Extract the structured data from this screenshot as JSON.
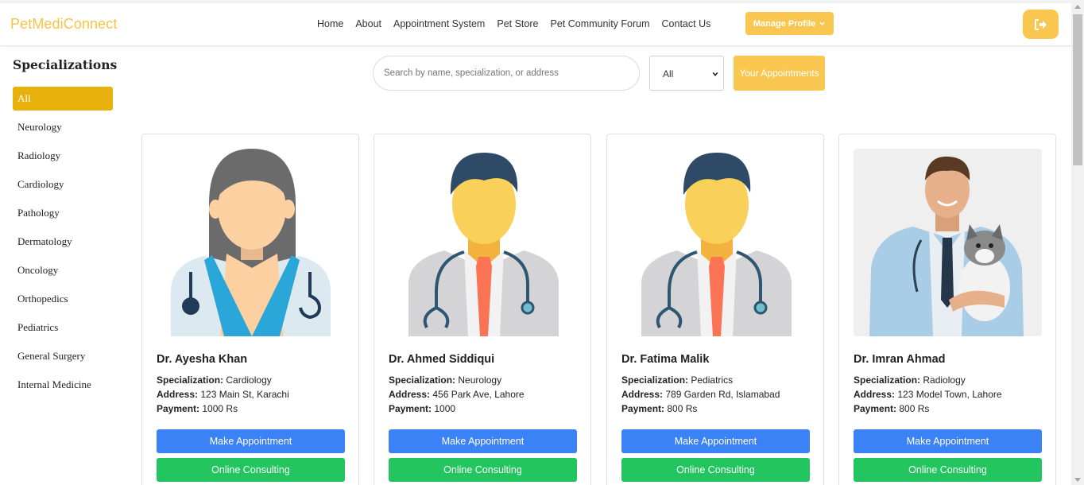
{
  "brand": "PetMediConnect",
  "nav": {
    "links": [
      "Home",
      "About",
      "Appointment System",
      "Pet Store",
      "Pet Community Forum",
      "Contact Us"
    ],
    "manage_profile": "Manage Profile",
    "icons": {
      "manage_chevron": "chevron-down-icon",
      "logout": "logout-icon"
    }
  },
  "sidebar": {
    "title": "Specializations",
    "items": [
      "All",
      "Neurology",
      "Radiology",
      "Cardiology",
      "Pathology",
      "Dermatology",
      "Oncology",
      "Orthopedics",
      "Pediatrics",
      "General Surgery",
      "Internal Medicine"
    ],
    "active": "All"
  },
  "search": {
    "placeholder": "Search by name, specialization, or address",
    "filter_value": "All",
    "your_appointments": "Your Appointments"
  },
  "labels": {
    "specialization": "Specialization:",
    "address": "Address:",
    "payment": "Payment:",
    "make_appointment": "Make Appointment",
    "online_consulting": "Online Consulting"
  },
  "doctors": [
    {
      "name": "Dr. Ayesha Khan",
      "specialization": "Cardiology",
      "address": "123 Main St, Karachi",
      "payment": "1000 Rs",
      "avatar": "female-doctor-avatar"
    },
    {
      "name": "Dr. Ahmed Siddiqui",
      "specialization": "Neurology",
      "address": "456 Park Ave, Lahore",
      "payment": "1000",
      "avatar": "male-doctor-avatar"
    },
    {
      "name": "Dr. Fatima Malik",
      "specialization": "Pediatrics",
      "address": "789 Garden Rd, Islamabad",
      "payment": "800 Rs",
      "avatar": "male-doctor-avatar"
    },
    {
      "name": "Dr. Imran Ahmad",
      "specialization": "Radiology",
      "address": "123 Model Town, Lahore",
      "payment": "800 Rs",
      "avatar": "vet-with-cat-photo"
    }
  ],
  "colors": {
    "accent": "#f9c74f",
    "active_item": "#e9b10e",
    "primary_button": "#3b82f6",
    "success_button": "#22c55e"
  }
}
